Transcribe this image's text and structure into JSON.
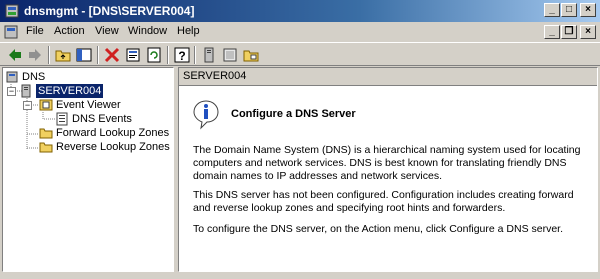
{
  "window": {
    "title": "dnsmgmt - [DNS\\SERVER004]"
  },
  "window_controls": {
    "minimize": "_",
    "maximize": "□",
    "close": "×"
  },
  "menu": {
    "items": [
      {
        "label": "File"
      },
      {
        "label": "Action"
      },
      {
        "label": "View"
      },
      {
        "label": "Window"
      },
      {
        "label": "Help"
      }
    ]
  },
  "mdi_controls": {
    "minimize": "_",
    "restore": "❐",
    "close": "×"
  },
  "toolbar": {
    "icons": [
      "back-arrow-icon",
      "forward-arrow-icon",
      "up-folder-icon",
      "show-hide-tree-icon",
      "delete-icon",
      "properties-icon",
      "refresh-icon",
      "help-icon",
      "server-icon",
      "zone-icon",
      "record-icon"
    ]
  },
  "tree": {
    "root": "DNS",
    "server": "SERVER004",
    "event_viewer": "Event Viewer",
    "dns_events": "DNS Events",
    "forward_zones": "Forward Lookup Zones",
    "reverse_zones": "Reverse Lookup Zones"
  },
  "details": {
    "header": "SERVER004",
    "heading": "Configure a DNS Server",
    "para1": "The Domain Name System (DNS) is a hierarchical naming system used for locating computers and network services. DNS is best known for translating friendly DNS domain names to IP addresses and network services.",
    "para2": "This DNS server has not been configured. Configuration includes creating forward and reverse lookup zones and specifying root hints and forwarders.",
    "para3": "To configure the DNS server, on the Action menu, click Configure a DNS server."
  },
  "colors": {
    "titlebar_start": "#0a246a",
    "titlebar_end": "#a6caf0",
    "chrome": "#d4d0c8",
    "selection": "#0a246a",
    "folder": "#f0d060"
  }
}
